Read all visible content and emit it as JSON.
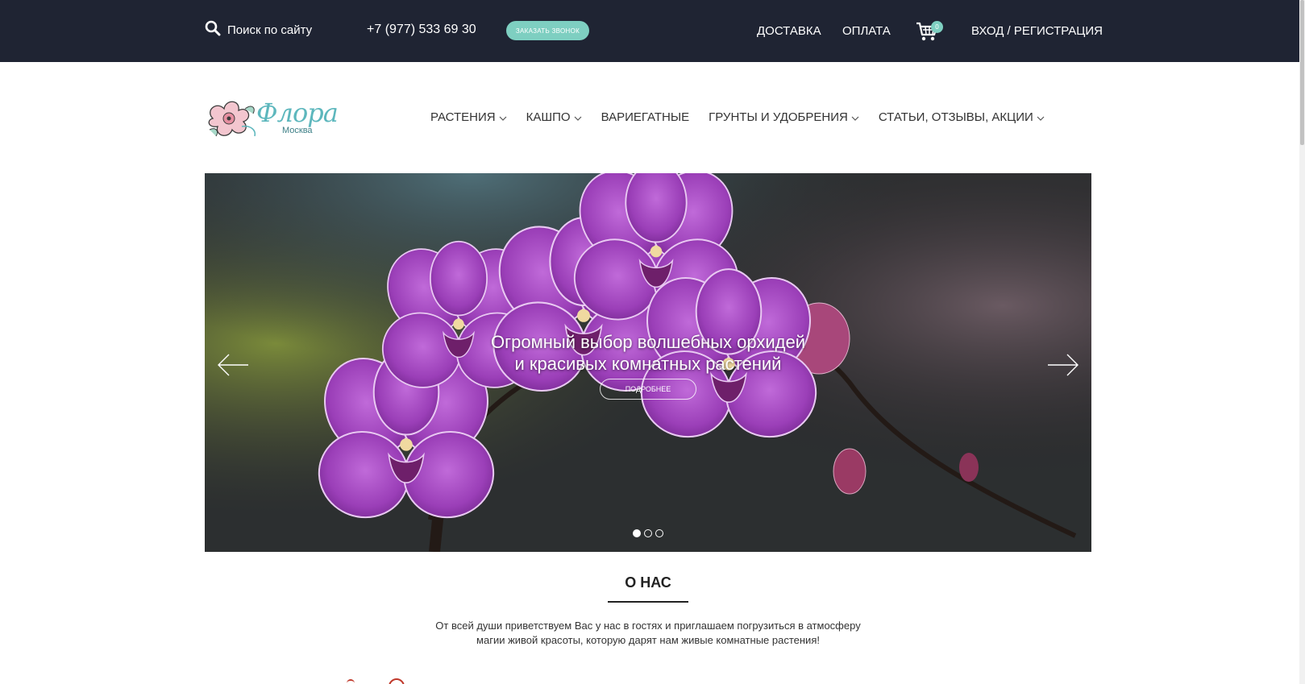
{
  "topbar": {
    "search_label": "Поиск по сайту",
    "phone": "+7 (977) 533 69 30",
    "callback_label": "ЗАКАЗАТЬ ЗВОНОК",
    "delivery": "ДОСТАВКА",
    "payment": "ОПЛАТА",
    "cart_count": "0",
    "login": "ВХОД / РЕГИСТРАЦИЯ"
  },
  "logo": {
    "script": "Флора",
    "city": "Москва"
  },
  "nav": [
    {
      "label": "РАСТЕНИЯ",
      "has_dropdown": true
    },
    {
      "label": "КАШПО",
      "has_dropdown": true
    },
    {
      "label": "ВАРИЕГАТНЫЕ",
      "has_dropdown": false
    },
    {
      "label": "ГРУНТЫ И УДОБРЕНИЯ",
      "has_dropdown": true
    },
    {
      "label": "СТАТЬИ, ОТЗЫВЫ, АКЦИИ",
      "has_dropdown": true
    }
  ],
  "slider": {
    "title_line1": "Огромный выбор волшебных орхидей",
    "title_line2": "и красивых комнатных растений",
    "button": "ПОДРОБНЕЕ",
    "slide_count": 3,
    "active_slide": 1
  },
  "about": {
    "title": "О НАС",
    "text_line1": "От всей души приветствуем Вас у нас в гостях и приглашаем погрузиться в атмосферу",
    "text_line2": "магии живой красоты, которую дарят нам живые комнатные растения!"
  },
  "colors": {
    "topbar_bg": "#1f2433",
    "accent": "#7ecfc1",
    "orchid": "#9b3fb8"
  }
}
